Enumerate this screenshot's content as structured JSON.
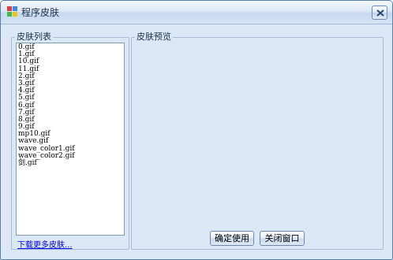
{
  "window": {
    "title": "程序皮肤"
  },
  "skin_list_group": {
    "legend": "皮肤列表",
    "items": [
      "0.gif",
      "1.gif",
      "10.gif",
      "11.gif",
      "2.gif",
      "3.gif",
      "4.gif",
      "5.gif",
      "6.gif",
      "7.gif",
      "8.gif",
      "9.gif",
      "mp10.gif",
      "wave.gif",
      "wave_color1.gif",
      "wave_color2.gif",
      "剑.gif"
    ],
    "more_link": "下载更多皮肤..."
  },
  "preview_group": {
    "legend": "皮肤预览"
  },
  "buttons": {
    "ok": "确定使用",
    "close": "关闭窗口"
  },
  "icons": {
    "app": "palette-icon",
    "close": "close-icon"
  },
  "colors": {
    "background": "#dde8f6",
    "border": "#5a7fb3",
    "link": "#0000ee"
  }
}
